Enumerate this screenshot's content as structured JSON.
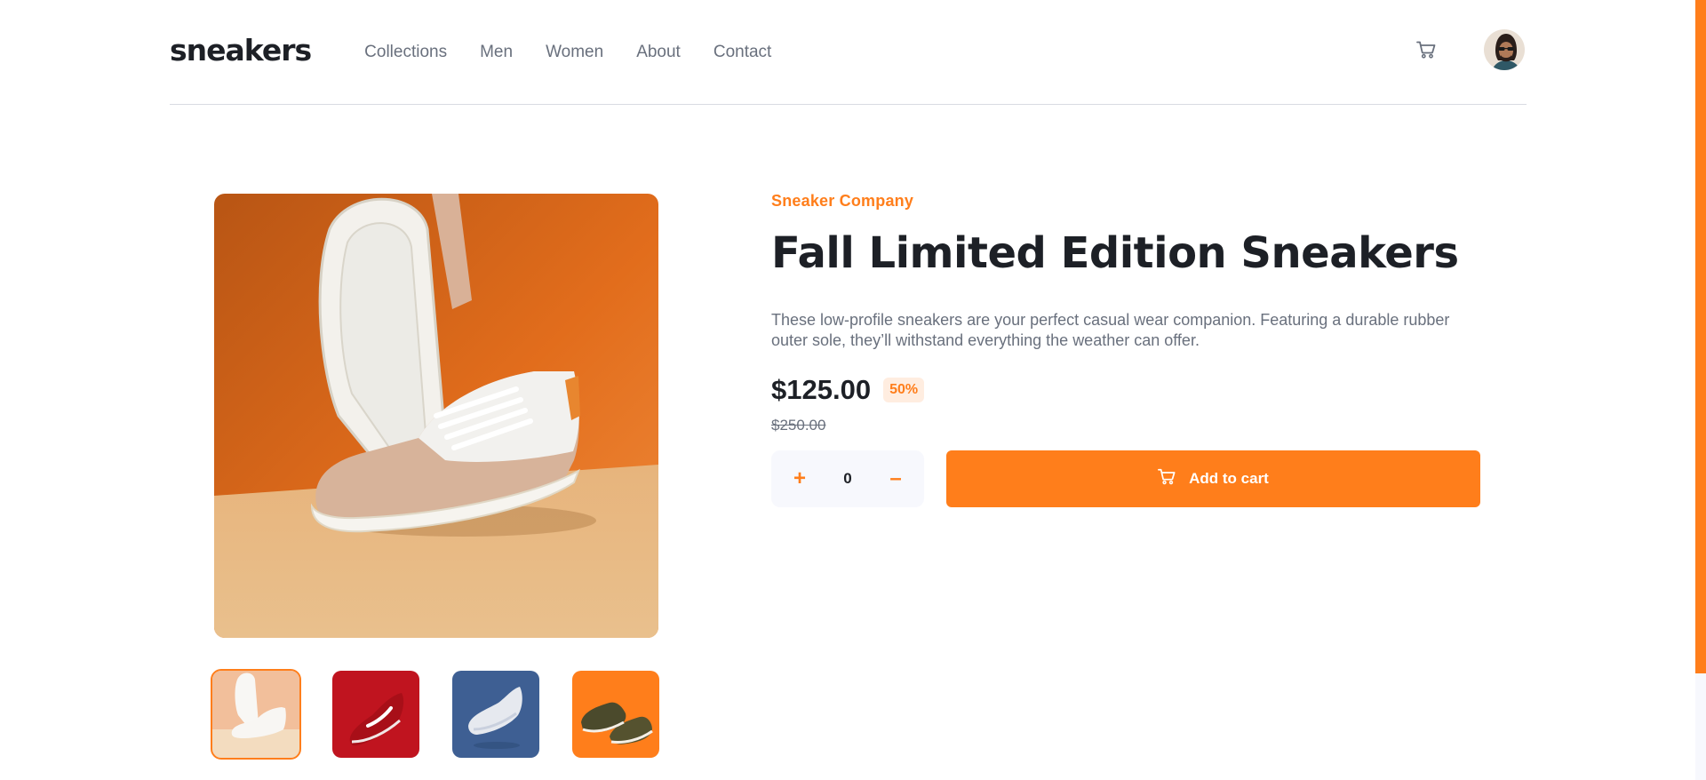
{
  "colors": {
    "accent": "#ff7e1b",
    "accent_pale": "#ffede0",
    "text_dark": "#1d2026",
    "text_muted": "#69707d"
  },
  "header": {
    "logo": "sneakers",
    "nav": [
      "Collections",
      "Men",
      "Women",
      "About",
      "Contact"
    ],
    "cart_icon": "cart-icon",
    "avatar_icon": "avatar"
  },
  "gallery": {
    "thumbnails": [
      {
        "name": "thumbnail-1",
        "active": true
      },
      {
        "name": "thumbnail-2",
        "active": false
      },
      {
        "name": "thumbnail-3",
        "active": false
      },
      {
        "name": "thumbnail-4",
        "active": false
      }
    ]
  },
  "product": {
    "company": "Sneaker Company",
    "title": "Fall Limited Edition Sneakers",
    "description": "These low-profile sneakers are your perfect casual wear companion. Featuring a durable rubber outer sole, they’ll withstand everything the weather can offer.",
    "price": "$125.00",
    "discount": "50%",
    "original_price": "$250.00"
  },
  "cart_controls": {
    "plus": "+",
    "quantity": "0",
    "minus": "–",
    "add_label": "Add to cart"
  }
}
